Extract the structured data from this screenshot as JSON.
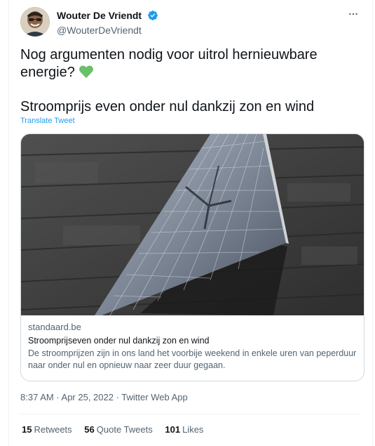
{
  "author": {
    "display_name": "Wouter De Vriendt",
    "handle": "@WouterDeVriendt",
    "verified": true
  },
  "tweet": {
    "text": "Nog argumenten nodig voor uitrol hernieuwbare energie?",
    "emoji": "green-heart",
    "text2": "Stroomprijs even onder nul dankzij zon en wind",
    "translate_label": "Translate Tweet"
  },
  "link_card": {
    "domain": "standaard.be",
    "title": "Stroomprijseven onder nul dankzij zon en wind",
    "description": "De stroomprijzen zijn in ons land het voorbije weekend in enkele uren van peperduur naar onder nul en opnieuw naar zeer duur gegaan."
  },
  "meta": {
    "timestamp": "8:37 AM · Apr 25, 2022 · Twitter Web App"
  },
  "stats": {
    "retweets_count": "15",
    "retweets_label": "Retweets",
    "quote_count": "56",
    "quote_label": "Quote Tweets",
    "likes_count": "101",
    "likes_label": "Likes"
  },
  "colors": {
    "accent": "#1d9bf0",
    "heart": "#5fbf5f",
    "text": "#0f1419",
    "muted": "#536471"
  },
  "icons": {
    "verified": "verified-badge-icon",
    "more": "more-options-icon",
    "heart": "green-heart-icon"
  }
}
